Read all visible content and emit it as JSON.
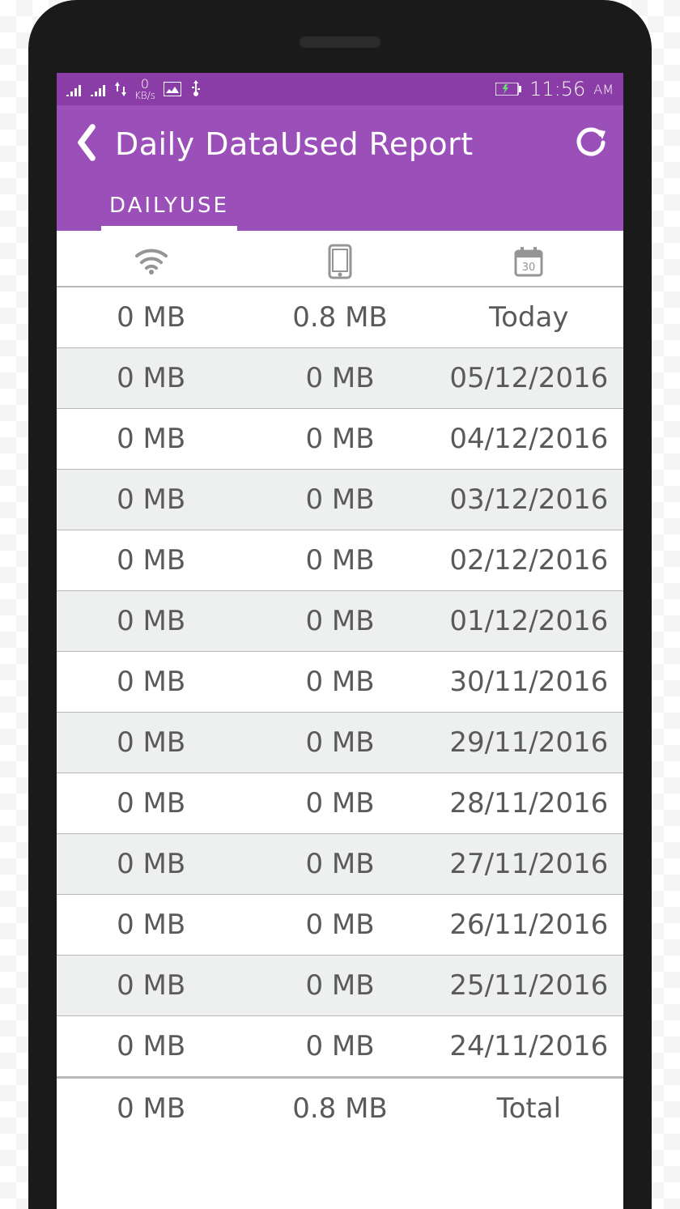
{
  "statusbar": {
    "kbs_value": "0",
    "kbs_unit": "KB/s",
    "time": "11:56",
    "ampm": "AM"
  },
  "appbar": {
    "title": "Daily DataUsed Report"
  },
  "tabs": {
    "dailyuse": "DAILYUSE"
  },
  "chart_data": {
    "type": "table",
    "columns": [
      "wifi",
      "mobile",
      "date"
    ],
    "rows": [
      {
        "wifi": "0 MB",
        "mobile": "0.8 MB",
        "date": "Today"
      },
      {
        "wifi": "0 MB",
        "mobile": "0 MB",
        "date": "05/12/2016"
      },
      {
        "wifi": "0 MB",
        "mobile": "0 MB",
        "date": "04/12/2016"
      },
      {
        "wifi": "0 MB",
        "mobile": "0 MB",
        "date": "03/12/2016"
      },
      {
        "wifi": "0 MB",
        "mobile": "0 MB",
        "date": "02/12/2016"
      },
      {
        "wifi": "0 MB",
        "mobile": "0 MB",
        "date": "01/12/2016"
      },
      {
        "wifi": "0 MB",
        "mobile": "0 MB",
        "date": "30/11/2016"
      },
      {
        "wifi": "0 MB",
        "mobile": "0 MB",
        "date": "29/11/2016"
      },
      {
        "wifi": "0 MB",
        "mobile": "0 MB",
        "date": "28/11/2016"
      },
      {
        "wifi": "0 MB",
        "mobile": "0 MB",
        "date": "27/11/2016"
      },
      {
        "wifi": "0 MB",
        "mobile": "0 MB",
        "date": "26/11/2016"
      },
      {
        "wifi": "0 MB",
        "mobile": "0 MB",
        "date": "25/11/2016"
      },
      {
        "wifi": "0 MB",
        "mobile": "0 MB",
        "date": "24/11/2016"
      }
    ],
    "total": {
      "wifi": "0 MB",
      "mobile": "0.8 MB",
      "date": "Total"
    }
  }
}
